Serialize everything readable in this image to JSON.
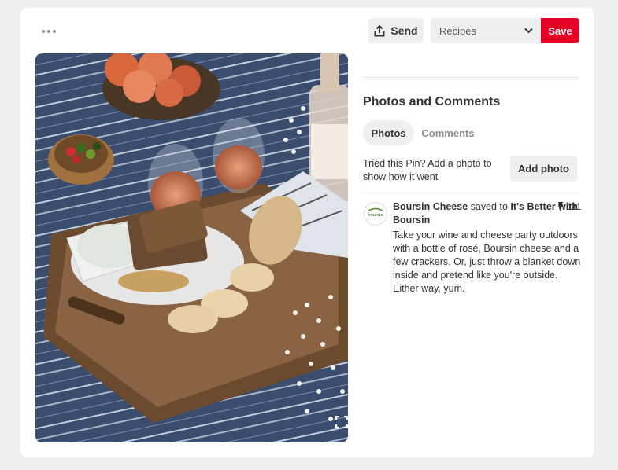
{
  "toolbar": {
    "send_label": "Send",
    "board_selected": "Recipes",
    "save_label": "Save"
  },
  "pin": {
    "image_alt": "Picnic with rosé wine, Boursin cheese, crackers and bread on a wooden tray"
  },
  "details": {
    "section_title": "Photos and Comments",
    "tabs": [
      {
        "label": "Photos",
        "active": true
      },
      {
        "label": "Comments",
        "active": false
      }
    ],
    "tried_prompt": "Tried this Pin? Add a photo to show how it went",
    "add_photo_label": "Add photo",
    "saver": {
      "name": "Boursin Cheese",
      "saved_to_text": "saved to",
      "board": "It's Better with Boursin",
      "repin_count": "111",
      "avatar_text": "boursin"
    },
    "description": "Take your wine and cheese party outdoors with a bottle of rosé, Boursin cheese and a few crackers. Or, just throw a blanket down inside and pretend like you're outside. Either way, yum."
  },
  "colors": {
    "save_red": "#e60023",
    "button_gray": "#efefef"
  }
}
